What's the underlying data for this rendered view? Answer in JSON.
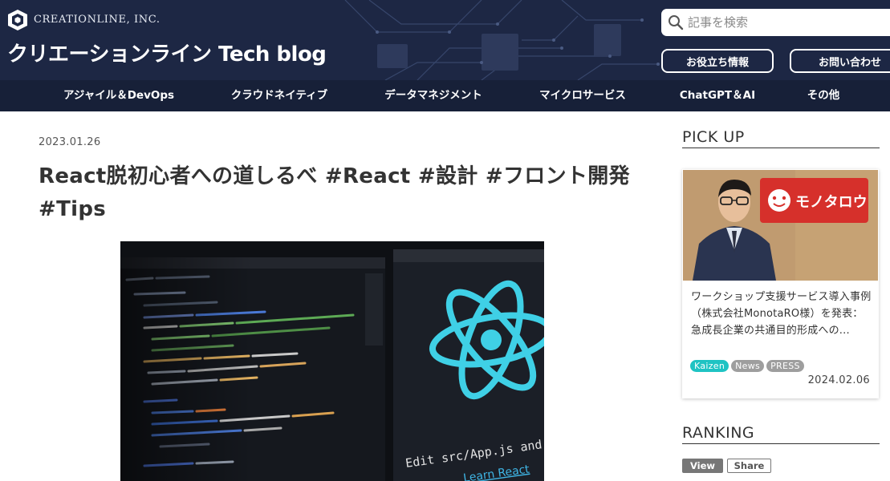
{
  "header": {
    "brand_name": "CREATIONLINE, INC.",
    "site_title": "クリエーションライン Tech blog",
    "search": {
      "placeholder": "記事を検索",
      "value": ""
    },
    "buttons": {
      "useful_info": "お役立ち情報",
      "contact": "お問い合わせ"
    },
    "icons": {
      "logo": "creationline-cube-logo",
      "search": "search-icon"
    },
    "colors": {
      "background": "#1d2744",
      "nav": "#172038"
    }
  },
  "nav": {
    "items": [
      {
        "label": "アジャイル＆DevOps"
      },
      {
        "label": "クラウドネイティブ"
      },
      {
        "label": "データマネジメント"
      },
      {
        "label": "マイクロサービス"
      },
      {
        "label": "ChatGPT＆AI"
      },
      {
        "label": "その他"
      }
    ]
  },
  "article": {
    "date": "2023.01.26",
    "title": "React脱初心者への道しるべ #React #設計 #フロント開発 #Tips",
    "hero": {
      "screen_text_1": "Edit src/App.js and save to rel",
      "screen_text_2": "Learn React",
      "icon": "react-logo"
    }
  },
  "sidebar": {
    "pickup": {
      "heading": "PICK UP",
      "card": {
        "title": "ワークショップ支援サービス導入事例（株式会社MonotaRO様）を発表：急成長企業の共通目的形成への...",
        "photo_sign": "モノタロウ",
        "tags": [
          "Kaizen",
          "News",
          "PRESS"
        ],
        "date": "2024.02.06"
      }
    },
    "ranking": {
      "heading": "RANKING",
      "tabs": [
        "View",
        "Share"
      ]
    }
  },
  "colors": {
    "accent_teal": "#1fc3c3",
    "tag_gray": "#9e9e9e",
    "react_cyan": "#3fd0e6",
    "sign_red": "#d6302b"
  }
}
